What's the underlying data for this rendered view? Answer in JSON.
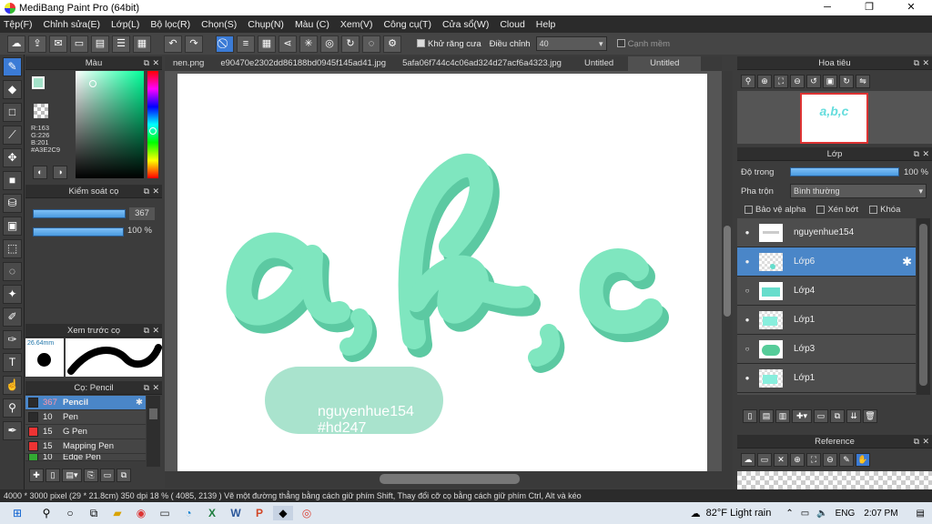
{
  "window": {
    "title": "MediBang Paint Pro (64bit)"
  },
  "menu": [
    "Tệp(F)",
    "Chỉnh sửa(E)",
    "Lớp(L)",
    "Bộ lọc(R)",
    "Chọn(S)",
    "Chụp(N)",
    "Màu (C)",
    "Xem(V)",
    "Công cụ(T)",
    "Cửa sổ(W)",
    "Cloud",
    "Help"
  ],
  "toolbar": {
    "antialias_label": "Khử răng cưa",
    "correction_label": "Điều chỉnh",
    "correction_value": "40",
    "soft_edge_label": "Cạnh mềm"
  },
  "color_panel": {
    "title": "Màu",
    "r": "R:163",
    "g": "G:226",
    "b": "B:201",
    "hex": "#A3E2C9",
    "color": "#A3E2C9"
  },
  "brush_control": {
    "title": "Kiểm soát cọ",
    "size": "367",
    "opacity": "100 %"
  },
  "brush_preview": {
    "title": "Xem trước cọ",
    "size_label": "26.64mm"
  },
  "brush_list": {
    "title": "Cọ: Pencil",
    "items": [
      {
        "size": "367",
        "name": "Pencil",
        "color": "#2b2b2b"
      },
      {
        "size": "10",
        "name": "Pen",
        "color": "#2b2b2b"
      },
      {
        "size": "15",
        "name": "G Pen",
        "color": "#e33"
      },
      {
        "size": "15",
        "name": "Mapping Pen",
        "color": "#e33"
      },
      {
        "size": "10",
        "name": "Edge Pen",
        "color": "#3a3"
      }
    ]
  },
  "tabs": [
    "nen.png",
    "e90470e2302dd86188bd0945f145ad41.jpg",
    "5afa06f744c4c06ad324d27acf6a4323.jpg",
    "Untitled",
    "Untitled"
  ],
  "canvas": {
    "watermark_name": "nguyenhue154",
    "watermark_tag": "#hd247",
    "letter_color": "#7fe6bf",
    "shadow_color": "#5cc9a2",
    "bubble_color": "#a9e3cd"
  },
  "navigator": {
    "title": "Hoa tiêu"
  },
  "layer_panel": {
    "title": "Lớp",
    "opacity_label": "Độ trong",
    "opacity_value": "100 %",
    "blend_label": "Pha trộn",
    "blend_value": "Bình thường",
    "protect_alpha": "Bảo vệ alpha",
    "clipping": "Xén bớt",
    "lock": "Khóa"
  },
  "layers": [
    {
      "name": "nguyenhue154"
    },
    {
      "name": "Lớp6"
    },
    {
      "name": "Lớp4"
    },
    {
      "name": "Lớp1"
    },
    {
      "name": "Lớp3"
    },
    {
      "name": "Lớp1"
    }
  ],
  "reference": {
    "title": "Reference"
  },
  "status": {
    "text": "4000 * 3000 pixel   (29 * 21.8cm)   350 dpi   18 %   ( 4085, 2139 )   Vẽ một đường thẳng bằng cách giữ phím Shift, Thay đổi cỡ cọ bằng cách giữ phím Ctrl, Alt và kéo"
  },
  "taskbar": {
    "weather": "82°F  Light rain",
    "lang": "ENG",
    "time": "2:07 PM"
  }
}
